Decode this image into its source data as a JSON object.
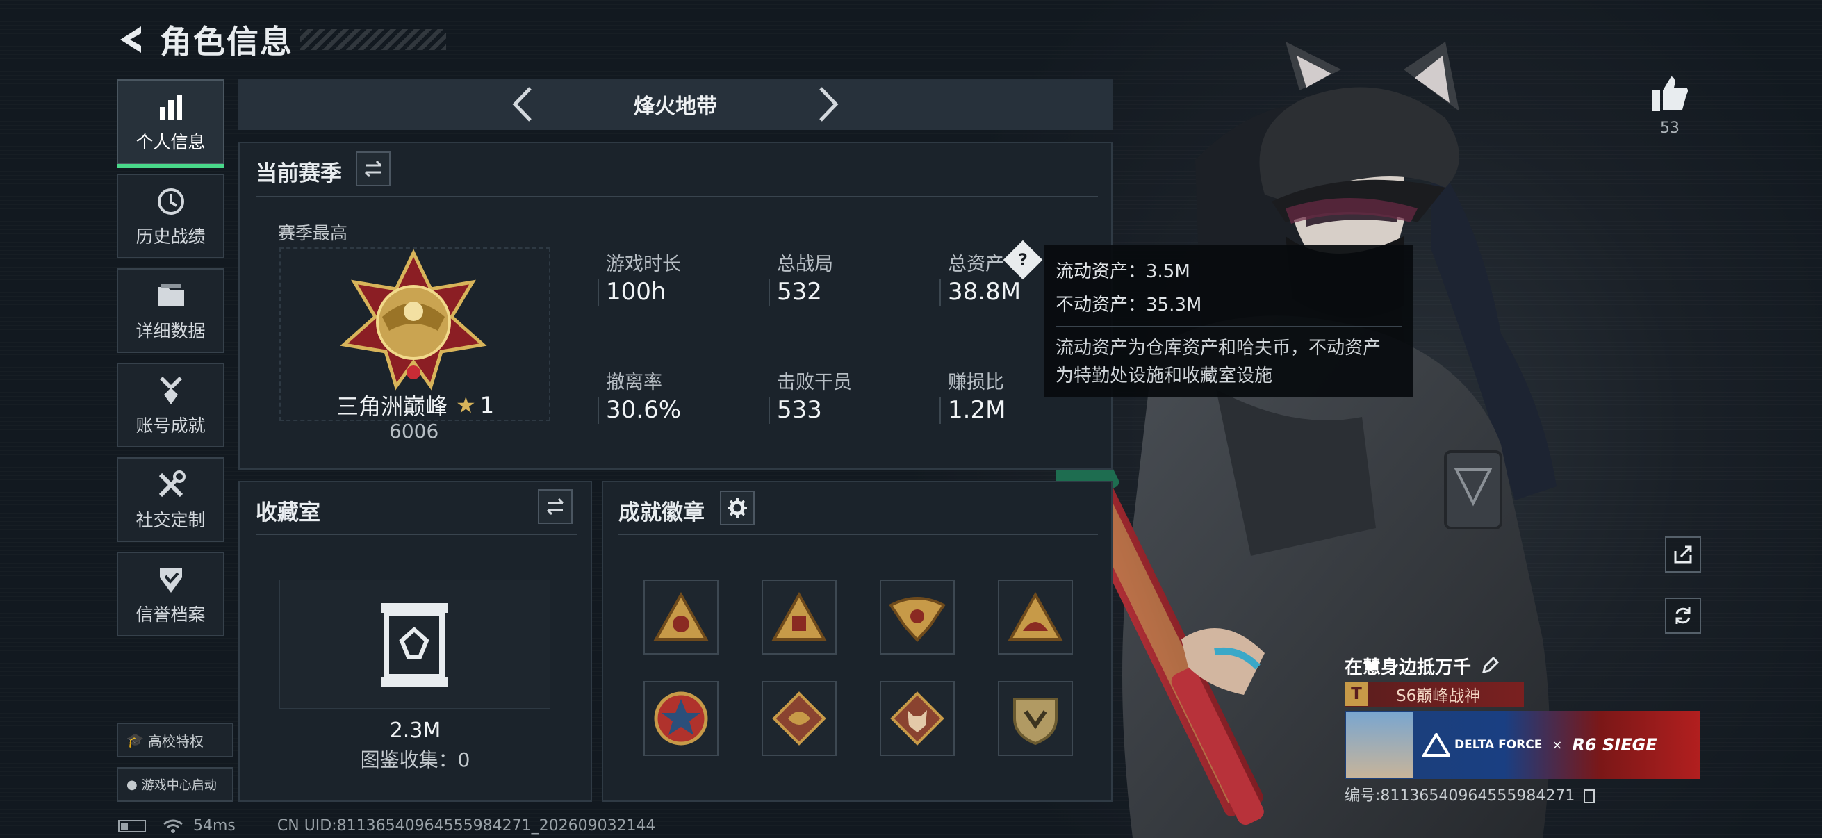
{
  "header": {
    "title": "角色信息"
  },
  "sidebar": {
    "items": [
      {
        "label": "个人信息",
        "icon": "bar-chart-icon",
        "active": true
      },
      {
        "label": "历史战绩",
        "icon": "history-clock-icon",
        "active": false
      },
      {
        "label": "详细数据",
        "icon": "folder-icon",
        "active": false
      },
      {
        "label": "账号成就",
        "icon": "medal-icon",
        "active": false
      },
      {
        "label": "社交定制",
        "icon": "tools-icon",
        "active": false
      },
      {
        "label": "信誉档案",
        "icon": "shield-check-icon",
        "active": false
      }
    ],
    "campus_label": "高校特权",
    "game_center_label": "游戏中心启动"
  },
  "mode_bar": {
    "title": "烽火地带"
  },
  "season": {
    "title": "当前赛季",
    "best_label": "赛季最高",
    "rank_name": "三角洲巅峰",
    "rank_stars": "1",
    "rank_score": "6006",
    "stats": [
      {
        "label": "游戏时长",
        "value": "100h"
      },
      {
        "label": "总战局",
        "value": "532"
      },
      {
        "label": "总资产",
        "value": "38.8M"
      },
      {
        "label": "撤离率",
        "value": "30.6%"
      },
      {
        "label": "击败干员",
        "value": "533"
      },
      {
        "label": "赚损比",
        "value": "1.2M"
      }
    ]
  },
  "tooltip": {
    "line1": "流动资产：3.5M",
    "line2": "不动资产：35.3M",
    "desc1": "流动资产为仓库资产和哈夫币，不动资产",
    "desc2": "为特勤处设施和收藏室设施"
  },
  "collection": {
    "title": "收藏室",
    "value": "2.3M",
    "catalog": "图鉴收集：0"
  },
  "badges": {
    "title": "成就徽章",
    "count": 8
  },
  "right": {
    "likes": "53",
    "player_name": "在慧身边抵万千",
    "title_tag": "S6巅峰战神",
    "banner_brand1": "DELTA FORCE",
    "banner_x": "×",
    "banner_brand2": "R6 SIEGE",
    "uid": "编号:81136540964555984271"
  },
  "status": {
    "ping": "54ms",
    "uid": "CN UID:81136540964555984271_202609032144"
  },
  "colors": {
    "accent_green": "#49d88a",
    "panel": "#1b232b",
    "tag_red": "#7a2020"
  }
}
